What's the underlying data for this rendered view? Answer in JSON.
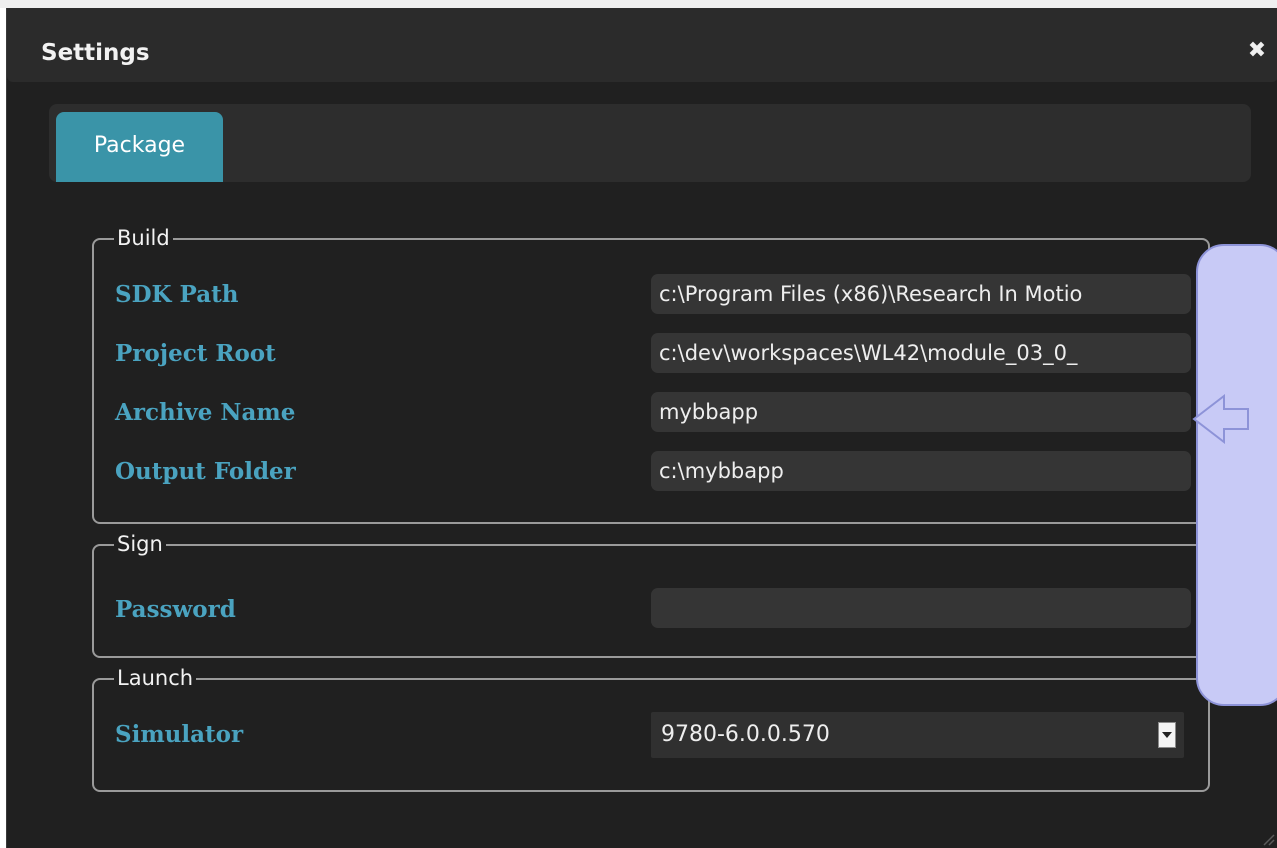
{
  "window": {
    "title": "Settings",
    "close_icon": "close-icon",
    "close_glyph": "✖"
  },
  "tabs": [
    {
      "label": "Package",
      "active": true
    }
  ],
  "build": {
    "legend": "Build",
    "fields": [
      {
        "label": "SDK Path",
        "value": "c:\\Program Files (x86)\\Research In Motio"
      },
      {
        "label": "Project Root",
        "value": "c:\\dev\\workspaces\\WL42\\module_03_0_"
      },
      {
        "label": "Archive Name",
        "value": "mybbapp"
      },
      {
        "label": "Output Folder",
        "value": "c:\\mybbapp"
      }
    ]
  },
  "sign": {
    "legend": "Sign",
    "password_label": "Password",
    "password_value": ""
  },
  "launch": {
    "legend": "Launch",
    "simulator_label": "Simulator",
    "simulator_value": "9780-6.0.0.570"
  },
  "icons": {
    "close": "close-icon",
    "dropdown": "chevron-down-icon",
    "callout_arrow": "arrow-left-icon",
    "resize": "resize-grip-icon"
  },
  "colors": {
    "background": "#202020",
    "tab_active": "#3a94a8",
    "label": "#4aa3c0",
    "callout_fill": "#c8caf6",
    "callout_border": "#8d93d8"
  }
}
